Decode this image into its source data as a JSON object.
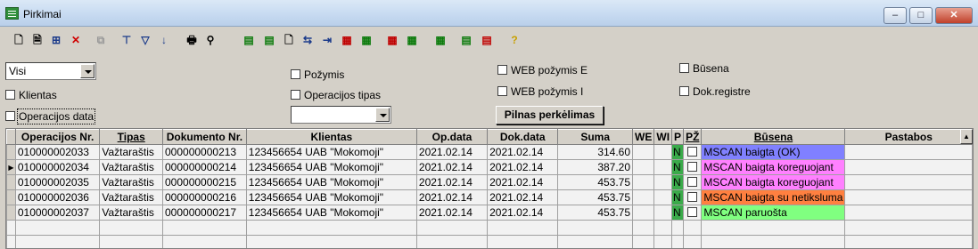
{
  "window": {
    "title": "Pirkimai"
  },
  "window_controls": {
    "minimize": "–",
    "maximize": "□",
    "close": "✕"
  },
  "toolbar": {
    "icons": [
      "new-doc-icon",
      "open-doc-icon",
      "tree-icon",
      "delete-icon",
      "copy-icon",
      "filter-edit-icon",
      "filter-icon",
      "sort-icon",
      "print-icon",
      "find-icon",
      "import-icon",
      "export-icon",
      "doc-copy-icon",
      "link-icon",
      "add-row-icon",
      "stack-icon",
      "stack-add-icon",
      "stack-red-icon",
      "stack-green-icon",
      "stack-up-icon",
      "stack-down-icon",
      "stack-remove-icon",
      "help-icon"
    ]
  },
  "filters": {
    "view_select": "Visi",
    "op_type_select": "",
    "klientas": "Klientas",
    "operacijos_data": "Operacijos data",
    "pozymis": "Požymis",
    "operacijos_tipas": "Operacijos tipas",
    "web_pozymis_e": "WEB požymis E",
    "web_pozymis_i": "WEB požymis I",
    "busena": "Būsena",
    "dok_registre": "Dok.registre",
    "full_transfer_button": "Pilnas perkėlimas"
  },
  "table": {
    "headers": [
      "Operacijos Nr.",
      "Tipas",
      "Dokumento Nr.",
      "Klientas",
      "Op.data",
      "Dok.data",
      "Suma",
      "WE",
      "WI",
      "P",
      "PŽ",
      "Būsena",
      "Pastabos"
    ],
    "rows": [
      {
        "op_nr": "010000002033",
        "tipas": "Važtaraštis",
        "dok_nr": "000000000213",
        "klientas": "123456654  UAB \"Mokomoji\"",
        "op_data": "2021.02.14",
        "dok_data": "2021.02.14",
        "suma": "314.60",
        "p": "N",
        "busena": "MSCAN baigta (OK)",
        "busena_color": "#8080ff",
        "pastabos": ""
      },
      {
        "op_nr": "010000002034",
        "tipas": "Važtaraštis",
        "dok_nr": "000000000214",
        "klientas": "123456654  UAB \"Mokomoji\"",
        "op_data": "2021.02.14",
        "dok_data": "2021.02.14",
        "suma": "387.20",
        "p": "N",
        "busena": "MSCAN baigta koreguojant",
        "busena_color": "#ff80ff",
        "pastabos": ""
      },
      {
        "op_nr": "010000002035",
        "tipas": "Važtaraštis",
        "dok_nr": "000000000215",
        "klientas": "123456654  UAB \"Mokomoji\"",
        "op_data": "2021.02.14",
        "dok_data": "2021.02.14",
        "suma": "453.75",
        "p": "N",
        "busena": "MSCAN baigta koreguojant",
        "busena_color": "#ff80ff",
        "pastabos": ""
      },
      {
        "op_nr": "010000002036",
        "tipas": "Važtaraštis",
        "dok_nr": "000000000216",
        "klientas": "123456654  UAB \"Mokomoji\"",
        "op_data": "2021.02.14",
        "dok_data": "2021.02.14",
        "suma": "453.75",
        "p": "N",
        "busena": "MSCAN baigta su netiksluma",
        "busena_color": "#ff8040",
        "pastabos": ""
      },
      {
        "op_nr": "010000002037",
        "tipas": "Važtaraštis",
        "dok_nr": "000000000217",
        "klientas": "123456654  UAB \"Mokomoji\"",
        "op_data": "2021.02.14",
        "dok_data": "2021.02.14",
        "suma": "453.75",
        "p": "N",
        "busena": "MSCAN paruošta",
        "busena_color": "#80ff80",
        "pastabos": ""
      }
    ],
    "current_row_marker": "▶"
  },
  "colors": {
    "n_flag": "#3aaa4a"
  }
}
